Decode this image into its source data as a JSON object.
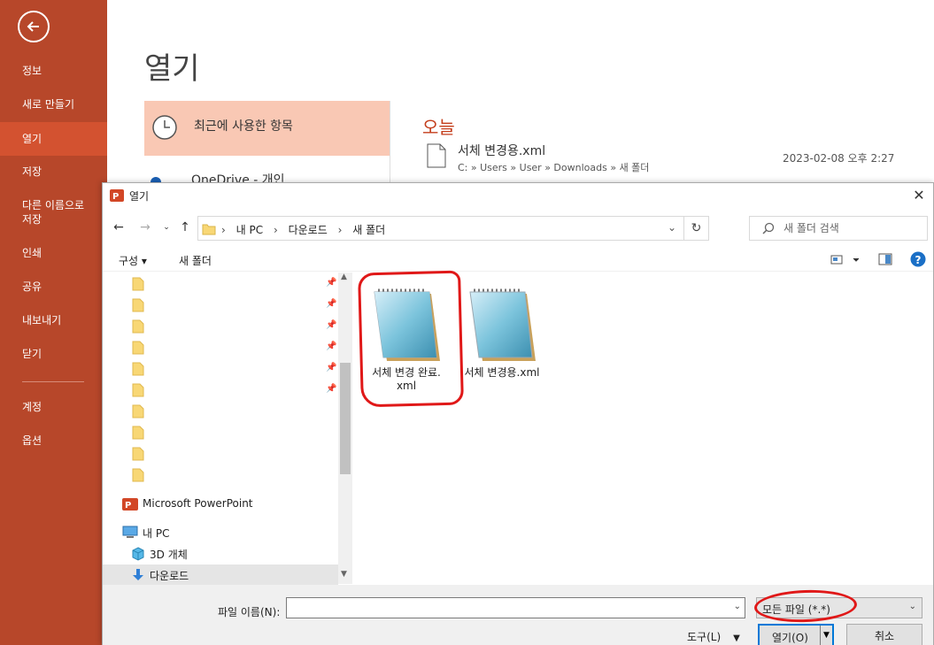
{
  "backstage": {
    "menu": [
      "정보",
      "새로 만들기",
      "열기",
      "저장",
      "다른 이름으로\n저장",
      "인쇄",
      "공유",
      "내보내기",
      "닫기",
      "계정",
      "옵션"
    ],
    "active_index": 2,
    "title": "열기",
    "locations": {
      "recent": "최근에 사용한 항목",
      "onedrive": "OneDrive - 개인"
    },
    "recent_group": "오늘",
    "recent_file": {
      "name": "서체 변경용.xml",
      "path": "C: » Users » User » Downloads » 새 폴더",
      "date": "2023-02-08 오후 2:27"
    }
  },
  "dialog": {
    "title": "열기",
    "close_glyph": "✕",
    "breadcrumb": [
      "내 PC",
      "다운로드",
      "새 폴더"
    ],
    "search_placeholder": "새 폴더 검색",
    "toolbar": {
      "organize": "구성 ▾",
      "new_folder": "새 폴더"
    },
    "nav": {
      "pinned_rows": 6,
      "unpinned_rows": 4,
      "powerpoint": "Microsoft PowerPoint",
      "this_pc": "내 PC",
      "objects_3d": "3D 개체",
      "downloads": "다운로드"
    },
    "files": [
      {
        "name_line1": "서체 변경 완료.",
        "name_line2": "xml",
        "annotated": true
      },
      {
        "name_line1": "서체 변경용.xml",
        "name_line2": "",
        "annotated": false
      }
    ],
    "bottom": {
      "filename_label": "파일 이름(N):",
      "filename_value": "",
      "filetype": "모든 파일 (*.*)",
      "tools": "도구(L)",
      "open": "열기(O)",
      "cancel": "취소"
    }
  },
  "colors": {
    "accent": "#b7472a",
    "accent_active": "#d35230",
    "highlight": "#f9c8b4",
    "annotation": "#e01818"
  }
}
